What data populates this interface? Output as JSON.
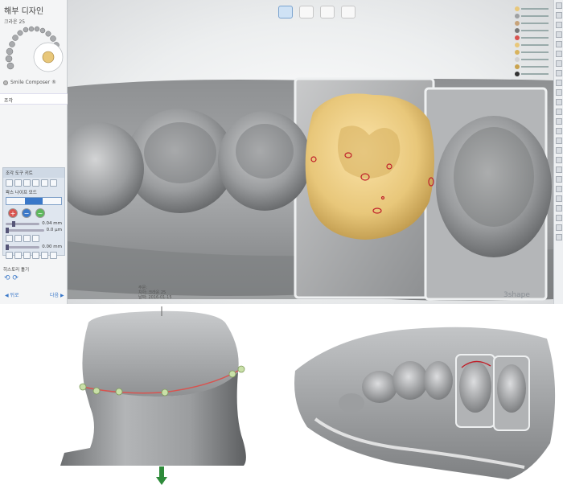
{
  "app": {
    "panel_title": "해부 디자인",
    "crown_label": "크라운 25",
    "smile_composer": "Smile Composer ®",
    "sculpt_item": "조각",
    "tools_header": "조각 도구 키트",
    "mode_label": "왁스 나이프 모드",
    "slider1_value": "0.04 mm",
    "slider2_value": "0.0 µm",
    "slider3_value": "0.00 mm",
    "history_label": "히스토리 툴기",
    "nav_back": "뒤로",
    "nav_next": "다음",
    "info_lines": [
      "주문:",
      "치아: 크라운 25",
      "날짜: 2016-01-15"
    ],
    "brand": "3shape"
  },
  "colors": {
    "crown": "#e8c77a",
    "die_stone": "#9ea0a2",
    "margin_line": "#d9534f",
    "accent": "#3a78c9"
  },
  "icons": [
    "tooth-view-icon",
    "model-view-icon",
    "jaw-view-icon",
    "fullscreen-view-icon",
    "add-icon",
    "subtract-icon",
    "smooth-icon",
    "insertion-arrow-icon"
  ]
}
